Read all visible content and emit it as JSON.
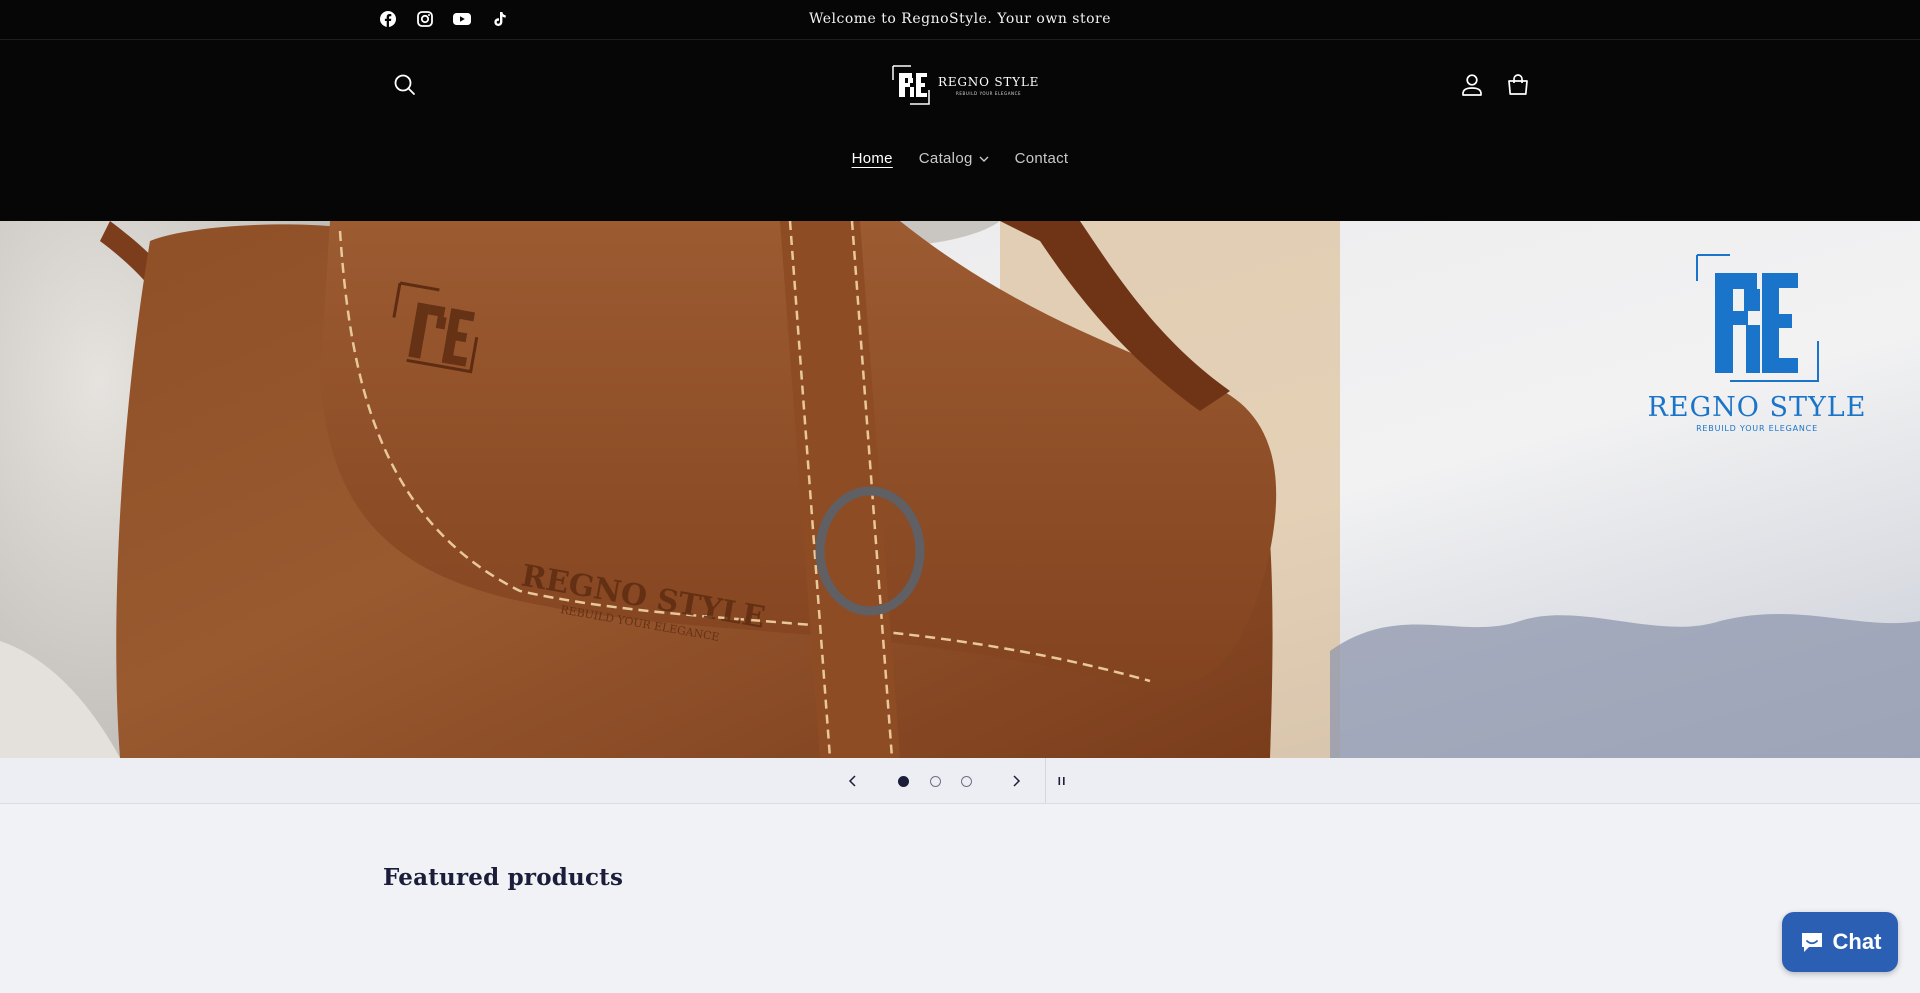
{
  "announcement": {
    "text": "Welcome to RegnoStyle. Your own store",
    "socials": [
      "facebook-icon",
      "instagram-icon",
      "youtube-icon",
      "tiktok-icon"
    ]
  },
  "header": {
    "logo_name": "REGNO STYLE",
    "logo_tagline": "REBUILD YOUR ELEGANCE",
    "nav": [
      {
        "label": "Home",
        "active": true
      },
      {
        "label": "Catalog",
        "has_dropdown": true
      },
      {
        "label": "Contact"
      }
    ],
    "icons": [
      "search-icon",
      "account-icon",
      "cart-icon"
    ]
  },
  "hero": {
    "bag_brand": "REGNO STYLE",
    "bag_tagline": "REBUILD YOUR ELEGANCE",
    "corner_logo_name": "REGNO STYLE",
    "corner_logo_tagline": "REBUILD YOUR ELEGANCE",
    "slides_total": 3,
    "current_slide": 1
  },
  "featured": {
    "title": "Featured products"
  },
  "chat": {
    "label": "Chat"
  },
  "colors": {
    "header_bg": "#060606",
    "page_bg": "#f1f2f6",
    "text_dark": "#1b1d3a",
    "chat_bg": "#2b5fb3",
    "logo_blue": "#1a74c9",
    "leather": "#8a4a24"
  }
}
